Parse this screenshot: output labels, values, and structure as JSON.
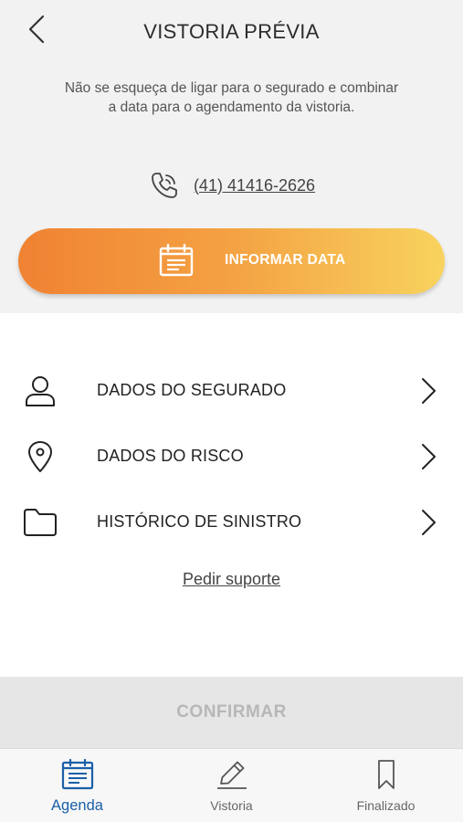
{
  "header": {
    "title": "VISTORIA PRÉVIA",
    "hint": "Não se esqueça de ligar para o segurado e combinar a data para o agendamento da vistoria.",
    "phone": "(41) 41416-2626",
    "cta_label": "INFORMAR DATA"
  },
  "menu": {
    "items": [
      {
        "label": "DADOS DO SEGURADO",
        "icon": "person-icon"
      },
      {
        "label": "DADOS DO RISCO",
        "icon": "location-pin-icon"
      },
      {
        "label": "HISTÓRICO DE SINISTRO",
        "icon": "folder-icon"
      }
    ],
    "support_link": "Pedir suporte"
  },
  "confirm": {
    "label": "CONFIRMAR",
    "enabled": false
  },
  "bottom_nav": {
    "items": [
      {
        "label": "Agenda",
        "icon": "calendar-list-icon",
        "active": true
      },
      {
        "label": "Vistoria",
        "icon": "pencil-icon",
        "active": false
      },
      {
        "label": "Finalizado",
        "icon": "bookmark-icon",
        "active": false
      }
    ]
  },
  "colors": {
    "accent_blue": "#1b5fa8",
    "cta_gradient_start": "#f08233",
    "cta_gradient_end": "#f8d35e",
    "top_panel_bg": "#f2f2f2",
    "confirm_disabled_bg": "#e6e6e6"
  }
}
